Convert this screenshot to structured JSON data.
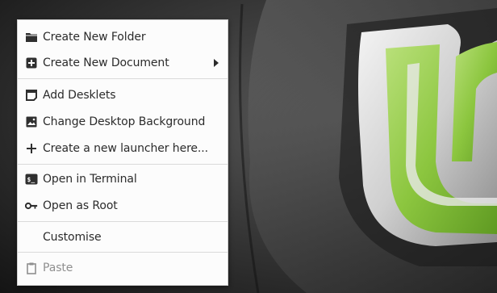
{
  "context_menu": {
    "items": [
      {
        "label": "Create New Folder",
        "icon": "folder-new-icon"
      },
      {
        "label": "Create New Document",
        "icon": "document-new-icon",
        "has_submenu": true
      },
      {
        "label": "Add Desklets",
        "icon": "desklet-icon"
      },
      {
        "label": "Change Desktop Background",
        "icon": "image-icon"
      },
      {
        "label": "Create a new launcher here...",
        "icon": "plus-icon"
      },
      {
        "label": "Open in Terminal",
        "icon": "terminal-icon"
      },
      {
        "label": "Open as Root",
        "icon": "key-icon"
      },
      {
        "label": "Customise",
        "icon": null
      },
      {
        "label": "Paste",
        "icon": "clipboard-icon",
        "disabled": true
      }
    ]
  },
  "colors": {
    "menu_background": "#fcfcfc",
    "menu_text": "#2b2b2b",
    "disabled_text": "#8f8f8f",
    "logo_green": "#8bc34a",
    "separator": "#dadada"
  }
}
